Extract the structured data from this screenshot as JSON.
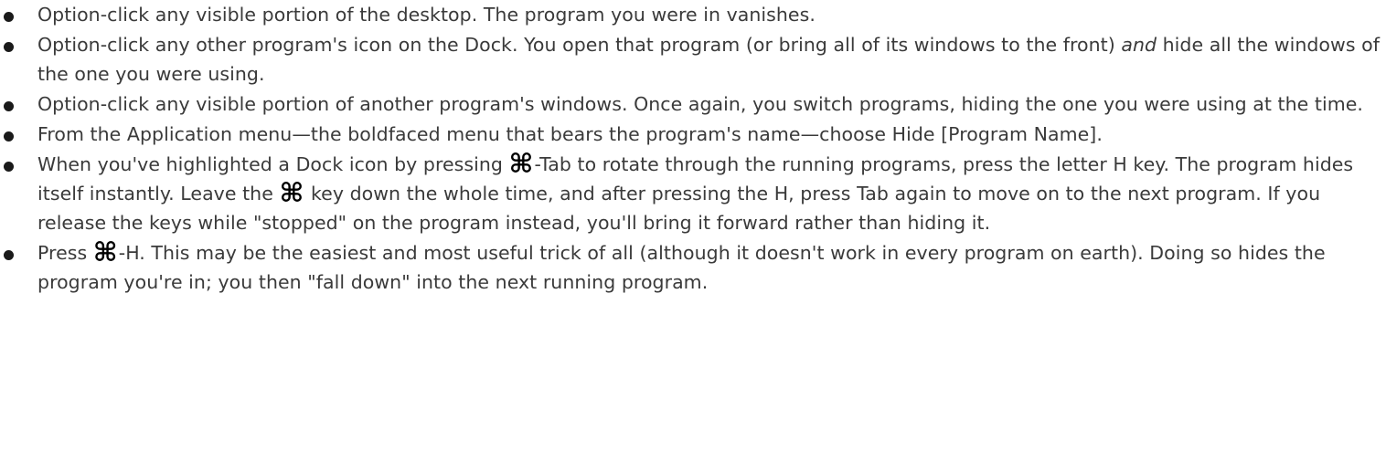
{
  "cmd_symbol": "⌘",
  "items": [
    {
      "text": "Option-click any visible portion of the desktop. The program you were in vanishes."
    },
    {
      "a": "Option-click any other program's icon on the Dock. You open that program (or bring all of its windows to the front) ",
      "em": "and",
      "b": " hide all the windows of the one you were using."
    },
    {
      "text": "Option-click any visible portion of another program's windows. Once again, you switch programs, hiding the one you were using at the time."
    },
    {
      "text": "From the Application menu—the boldfaced menu that bears the program's name—choose Hide [Program Name]."
    },
    {
      "a": "When you've highlighted a Dock icon by pressing ",
      "b": "-Tab to rotate through the running programs, press the letter H key. The program hides itself instantly. Leave the ",
      "c": " key down the whole time, and after pressing the H, press Tab again to move on to the next program. If you release the keys while \"stopped\" on the program instead, you'll bring it forward rather than hiding it."
    },
    {
      "a": "Press ",
      "b": "-H. This may be the easiest and most useful trick of all (although it doesn't work in every program on earth). Doing so hides the program you're in; you then \"fall down\" into the next running program."
    }
  ]
}
